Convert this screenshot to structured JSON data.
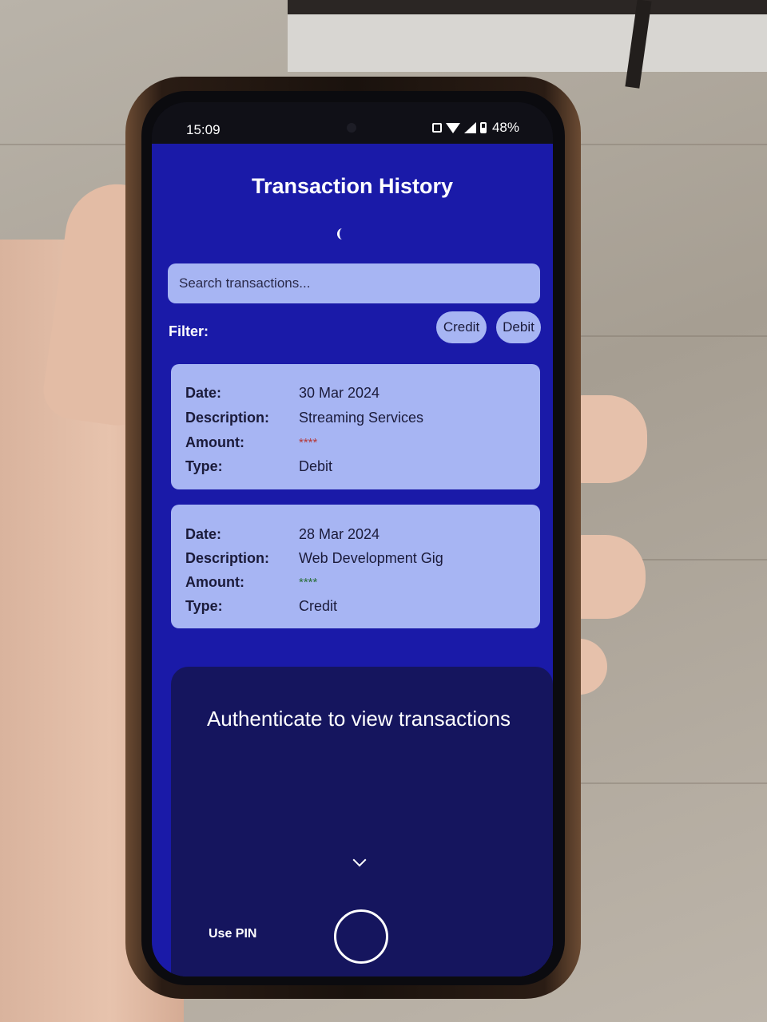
{
  "status_bar": {
    "time": "15:09",
    "battery": "48%"
  },
  "app": {
    "title": "Transaction History",
    "search": {
      "placeholder": "Search transactions...",
      "value": ""
    },
    "filter": {
      "label": "Filter:",
      "credit_label": "Credit",
      "debit_label": "Debit"
    },
    "transactions": [
      {
        "date_label": "Date:",
        "date": "30 Mar 2024",
        "description_label": "Description:",
        "description": "Streaming Services",
        "amount_label": "Amount:",
        "amount": "****",
        "type_label": "Type:",
        "type": "Debit"
      },
      {
        "date_label": "Date:",
        "date": "28 Mar 2024",
        "description_label": "Description:",
        "description": "Web Development Gig",
        "amount_label": "Amount:",
        "amount": "****",
        "type_label": "Type:",
        "type": "Credit"
      }
    ]
  },
  "auth_sheet": {
    "title": "Authenticate to view transactions",
    "use_pin_label": "Use PIN"
  },
  "colors": {
    "app_background": "#1a1aa8",
    "card_background": "#a7b5f3",
    "sheet_background": "#15155e",
    "debit_amount": "#b53a3a",
    "credit_amount": "#2b6e3a"
  },
  "icons": [
    "nfc-icon",
    "wifi-icon",
    "signal-icon",
    "battery-icon",
    "chevron-down-icon",
    "fingerprint-icon"
  ]
}
